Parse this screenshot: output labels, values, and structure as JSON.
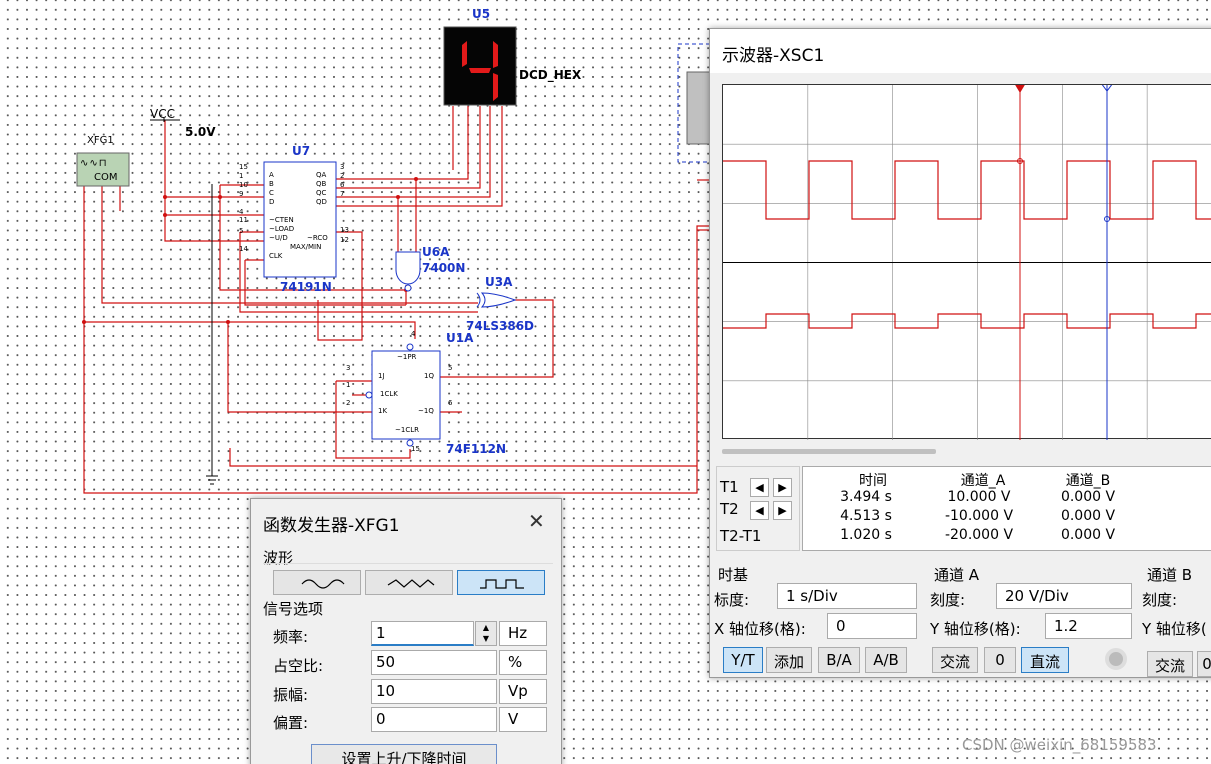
{
  "schematic": {
    "u5_label": "U5",
    "dcd_hex": "DCD_HEX",
    "display_digit": "4",
    "xfg1": "XFG1",
    "com": "COM",
    "vcc": "VCC",
    "v5": "5.0V",
    "u7": "U7",
    "u7_part": "74191N",
    "u7_pins_left": [
      "A",
      "B",
      "C",
      "D",
      "~CTEN",
      "~LOAD",
      "~U/D",
      "CLK"
    ],
    "u7_pins_right": [
      "QA",
      "QB",
      "QC",
      "QD",
      "~RCO",
      "MAX/MIN"
    ],
    "u7_pinnum_left": [
      "15",
      "1",
      "10",
      "9",
      "4",
      "11",
      "5",
      "14"
    ],
    "u7_pinnum_right": [
      "3",
      "2",
      "6",
      "7",
      "13",
      "12"
    ],
    "u6a": "U6A",
    "u6a_part": "7400N",
    "u3a": "U3A",
    "u3a_part": "74LS386D",
    "u1a": "U1A",
    "u1a_part": "74F112N",
    "u1a_pins": [
      "~1PR",
      "1J",
      "1CLK",
      "1K",
      "~1CLR",
      "1Q",
      "~1Q"
    ],
    "u1a_pinnums": [
      "4",
      "3",
      "1",
      "2",
      "15",
      "5",
      "6"
    ]
  },
  "func_gen": {
    "title": "函数发生器-XFG1",
    "close": "✕",
    "waveform_group": "波形",
    "signal_group": "信号选项",
    "freq_label": "频率:",
    "freq_value": "1",
    "freq_unit": "Hz",
    "duty_label": "占空比:",
    "duty_value": "50",
    "duty_unit": "%",
    "amp_label": "振幅:",
    "amp_value": "10",
    "amp_unit": "Vp",
    "offset_label": "偏置:",
    "offset_value": "0",
    "offset_unit": "V",
    "rise_fall_button": "设置上升/下降时间",
    "selected_waveform": "square"
  },
  "oscilloscope": {
    "title": "示波器-XSC1",
    "headers": [
      "时间",
      "通道_A",
      "通道_B"
    ],
    "rows": [
      {
        "label": "T1",
        "time": "3.494 s",
        "a": "10.000 V",
        "b": "0.000 V"
      },
      {
        "label": "T2",
        "time": "4.513 s",
        "a": "-10.000 V",
        "b": "0.000 V"
      },
      {
        "label": "T2-T1",
        "time": "1.020 s",
        "a": "-20.000 V",
        "b": "0.000 V"
      }
    ],
    "timebase": {
      "group": "时基",
      "scale_label": "标度:",
      "scale_value": "1  s/Div",
      "xpos_label": "X 轴位移(格):",
      "xpos_value": "0",
      "buttons": [
        "Y/T",
        "添加",
        "B/A",
        "A/B"
      ]
    },
    "chA": {
      "group": "通道 A",
      "scale_label": "刻度:",
      "scale_value": "20  V/Div",
      "ypos_label": "Y 轴位移(格):",
      "ypos_value": "1.2",
      "buttons": [
        "交流",
        "0",
        "直流"
      ]
    },
    "chB": {
      "group": "通道 B",
      "scale_label": "刻度:",
      "ypos_label": "Y 轴位移(",
      "buttons": [
        "交流",
        "0"
      ]
    },
    "trace_color": "#d01010",
    "cursor1_color": "#d01010",
    "cursor2_color": "#1a35c8"
  },
  "watermark": "CSDN @weixin_68159583"
}
